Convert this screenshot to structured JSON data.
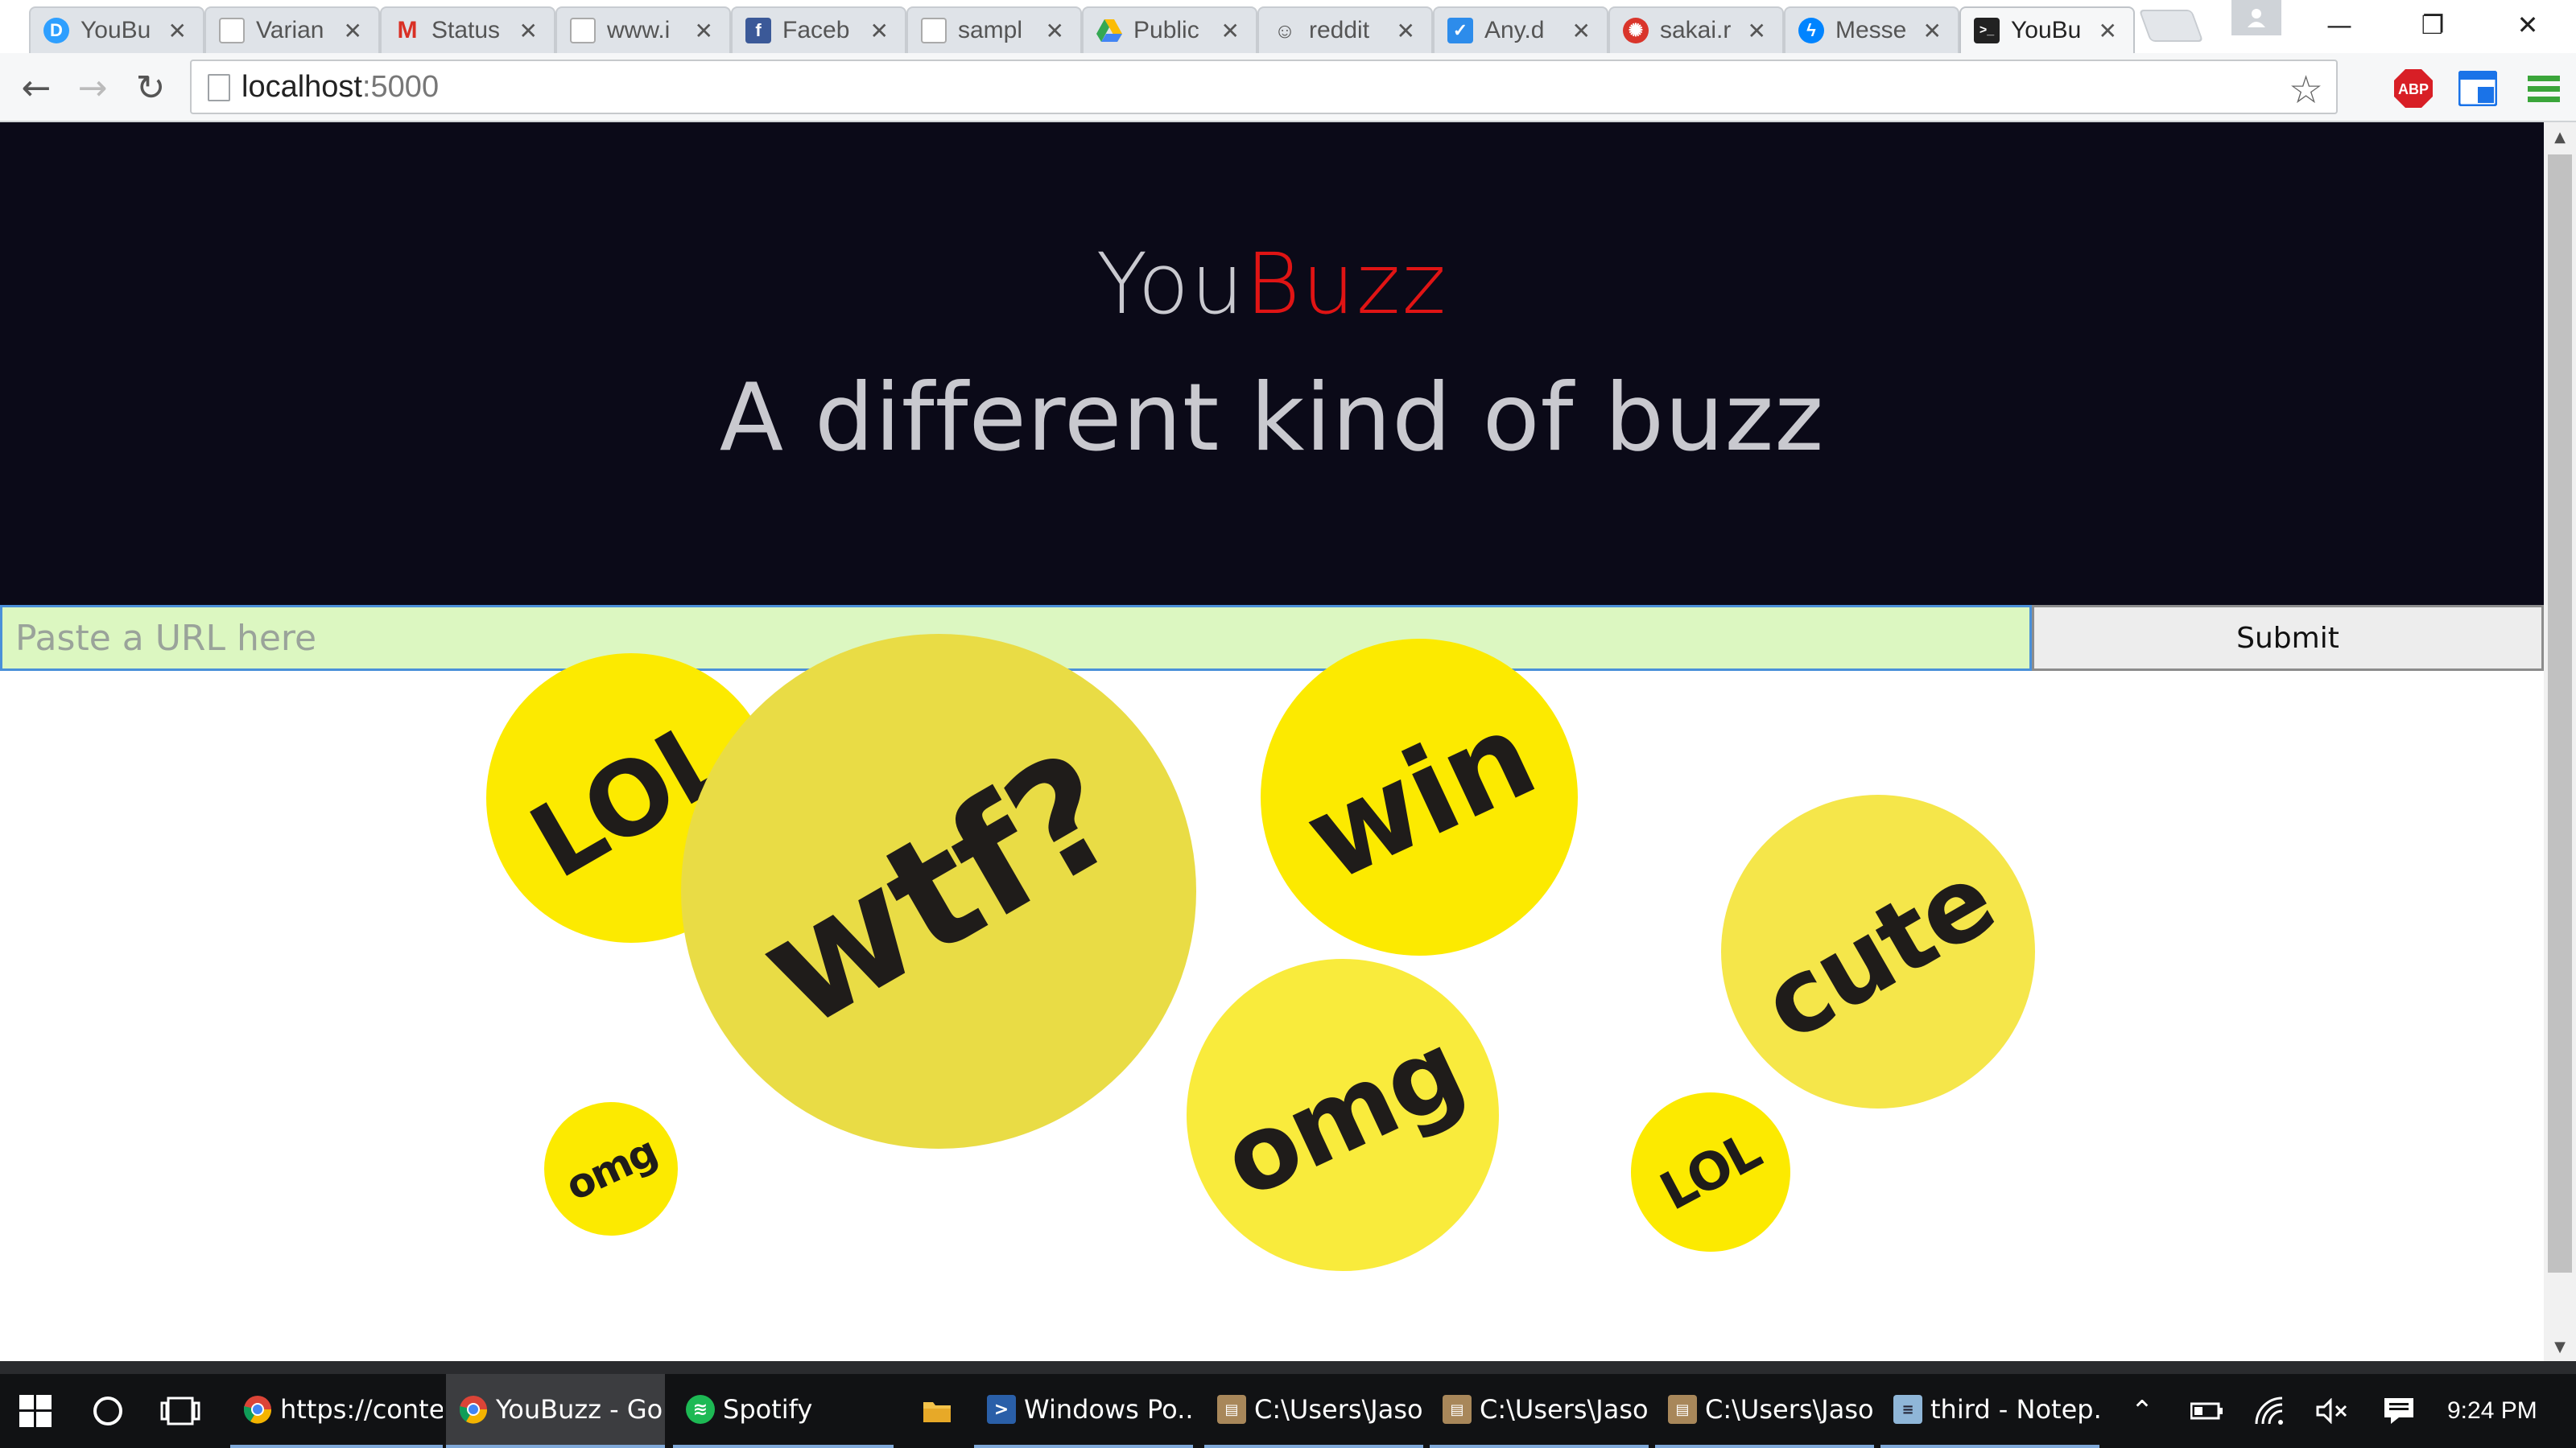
{
  "browser": {
    "tabs": [
      {
        "title": "YouBu",
        "icon": "disqus-icon",
        "color": "#2e9fff"
      },
      {
        "title": "Varian",
        "icon": "page-icon",
        "color": "#ffffff"
      },
      {
        "title": "Status",
        "icon": "gmail-icon",
        "color": "#d93025"
      },
      {
        "title": "www.i",
        "icon": "page-icon",
        "color": "#ffffff"
      },
      {
        "title": "Faceb",
        "icon": "facebook-icon",
        "color": "#3b5998"
      },
      {
        "title": "sampl",
        "icon": "page-icon",
        "color": "#ffffff"
      },
      {
        "title": "Public",
        "icon": "google-drive-icon",
        "color": "#34a853"
      },
      {
        "title": "reddit",
        "icon": "reddit-icon",
        "color": "#ff4500"
      },
      {
        "title": "Any.d",
        "icon": "anydo-icon",
        "color": "#2d8ceb"
      },
      {
        "title": "sakai.r",
        "icon": "sakai-icon",
        "color": "#d9352b"
      },
      {
        "title": "Messe",
        "icon": "messenger-icon",
        "color": "#0084ff"
      },
      {
        "title": "YouBu",
        "icon": "terminal-icon",
        "color": "#222222",
        "active": true
      }
    ],
    "url_host": "localhost",
    "url_port": ":5000",
    "extensions": {
      "abp": "ABP"
    }
  },
  "page": {
    "brand_you": "You",
    "brand_buzz": "Buzz",
    "tagline": "A different kind of buzz",
    "url_placeholder": "Paste a URL here",
    "submit_label": "Submit",
    "bubbles": [
      {
        "word": "LOL",
        "color": "#fcea00"
      },
      {
        "word": "wtf?",
        "color": "#e9dc45"
      },
      {
        "word": "win",
        "color": "#fcea00"
      },
      {
        "word": "cute",
        "color": "#f5e64a"
      },
      {
        "word": "omg",
        "color": "#fcea00"
      },
      {
        "word": "omg",
        "color": "#f9eb3c"
      },
      {
        "word": "LOL",
        "color": "#fcea00"
      }
    ]
  },
  "taskbar": {
    "items": [
      {
        "label": "https://conte...",
        "icon": "chrome-icon"
      },
      {
        "label": "YouBuzz - Go...",
        "icon": "chrome-icon"
      },
      {
        "label": "Spotify",
        "icon": "spotify-icon"
      },
      {
        "label": "",
        "icon": "folder-icon"
      },
      {
        "label": "Windows Po...",
        "icon": "powershell-icon"
      },
      {
        "label": "C:\\Users\\Jaso...",
        "icon": "console-icon"
      },
      {
        "label": "C:\\Users\\Jaso...",
        "icon": "console-icon"
      },
      {
        "label": "C:\\Users\\Jaso...",
        "icon": "console-icon"
      },
      {
        "label": "third - Notep...",
        "icon": "notepad-icon"
      }
    ],
    "clock": "9:24 PM"
  }
}
